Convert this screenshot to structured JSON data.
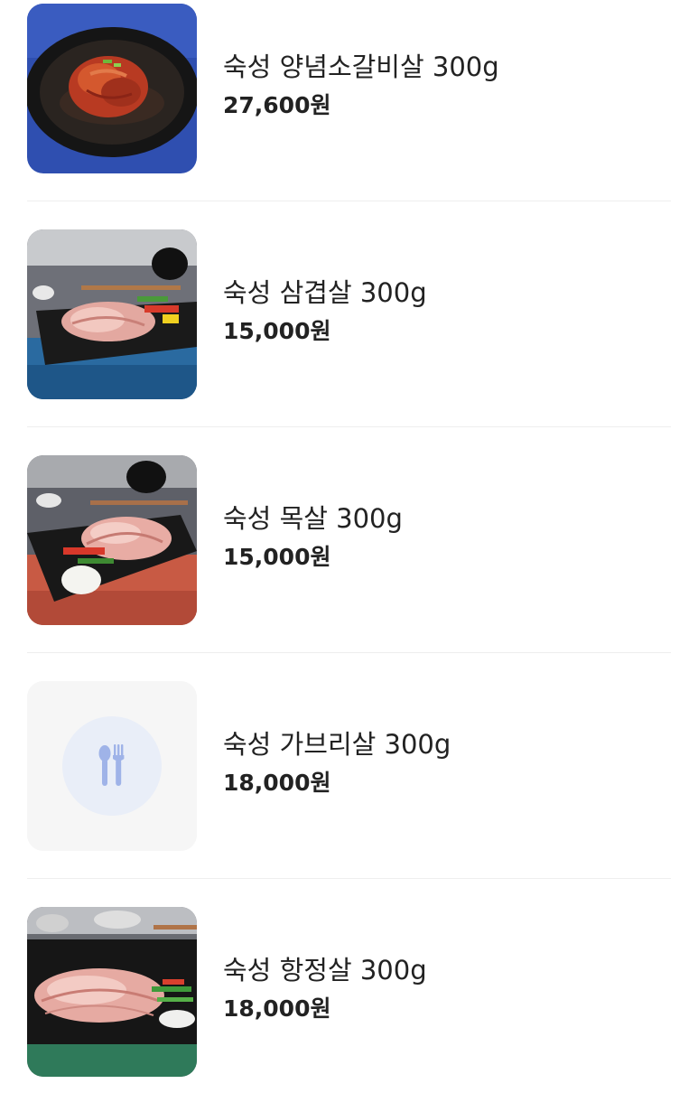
{
  "items": [
    {
      "name": "숙성 양념소갈비살 300g",
      "price": "27,600원",
      "image": "marinated-beef-rib-photo"
    },
    {
      "name": "숙성 삼겹살 300g",
      "price": "15,000원",
      "image": "pork-belly-photo"
    },
    {
      "name": "숙성 목살 300g",
      "price": "15,000원",
      "image": "pork-neck-photo"
    },
    {
      "name": "숙성 가브리살 300g",
      "price": "18,000원",
      "image": "utensils-placeholder-icon"
    },
    {
      "name": "숙성 항정살 300g",
      "price": "18,000원",
      "image": "pork-jowl-photo"
    }
  ],
  "colors": {
    "text": "#222222",
    "divider": "#eeeeee",
    "placeholder_bg": "#f6f6f6",
    "placeholder_circle": "#e9eef8",
    "placeholder_icon": "#9fb3e8"
  }
}
